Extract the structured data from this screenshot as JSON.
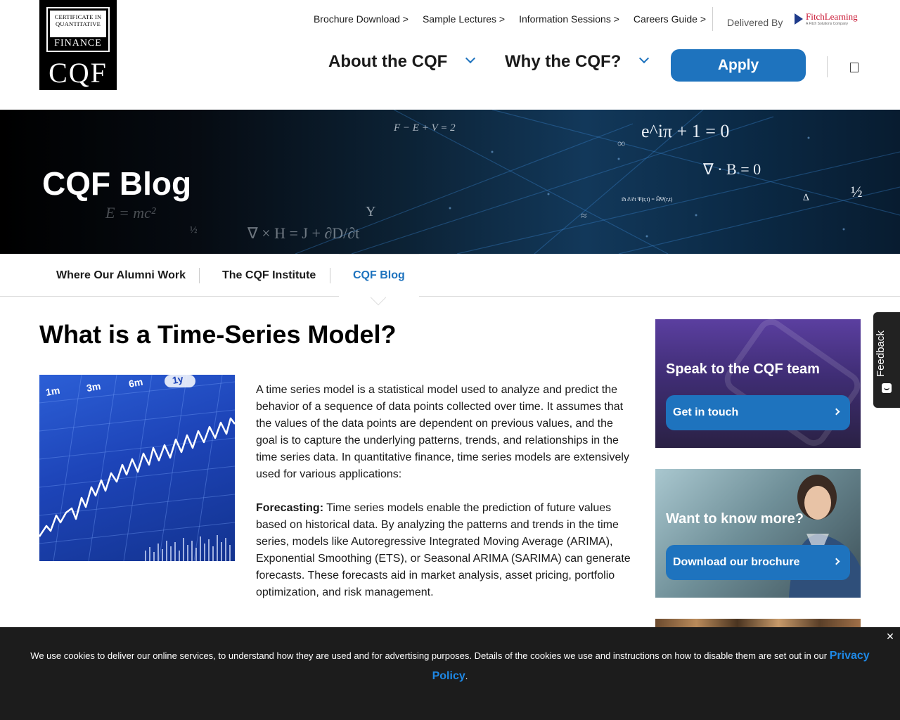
{
  "header": {
    "logo": {
      "line1": "CERTIFICATE IN",
      "line2": "QUANTITATIVE",
      "line3": "FINANCE",
      "mark": "CQF"
    },
    "top_links": [
      "Brochure Download >",
      "Sample Lectures >",
      "Information Sessions >",
      "Careers Guide >"
    ],
    "delivered_by": "Delivered By",
    "partner": {
      "name": "FitchLearning",
      "tagline": "A Fitch Solutions Company"
    },
    "nav": [
      {
        "label": "About the CQF",
        "icon": "chevron-down-icon"
      },
      {
        "label": "Why the CQF?",
        "icon": "chevron-down-icon"
      }
    ],
    "apply_label": "Apply",
    "search_icon": "search-icon"
  },
  "hero": {
    "title": "CQF Blog",
    "equations": [
      "F − E + V = 2",
      "e^iπ + 1 = 0",
      "∇ · B = 0",
      "E = mc²",
      "∇ × H = J + ∂D/∂t",
      "½",
      "½",
      "∆",
      "≈",
      "Υ",
      "∞",
      "iħ ∂/∂t Ψ(r,t) = ĤΨ(r,t)"
    ]
  },
  "subnav": {
    "items": [
      "Where Our Alumni Work",
      "The CQF Institute",
      "CQF Blog"
    ],
    "active_index": 2
  },
  "article": {
    "title": "What is a Time-Series Model?",
    "image_labels": [
      "1m",
      "3m",
      "6m",
      "1y"
    ],
    "intro": "A time series model is a statistical model used to analyze and predict the behavior of a sequence of data points collected over time. It assumes that the values of the data points are dependent on previous values, and the goal is to capture the underlying patterns, trends, and relationships in the time series data. In quantitative finance, time series models are extensively used for various applications:",
    "forecasting_label": "Forecasting:",
    "forecasting_text": " Time series models enable the prediction of future values based on historical data. By analyzing the patterns and trends in the time series, models like Autoregressive Integrated Moving Average (ARIMA), Exponential Smoothing (ETS), or Seasonal ARIMA (SARIMA) can generate forecasts. These forecasts aid in market analysis, asset pricing, portfolio optimization, and risk management."
  },
  "sidebar": {
    "card1": {
      "title": "Speak to the CQF team",
      "button": "Get in touch"
    },
    "card2": {
      "title": "Want to know more?",
      "button": "Download our brochure"
    }
  },
  "feedback": {
    "label": "Feedback"
  },
  "cookie": {
    "message": "We use cookies to deliver our online services, to understand how they are used and for advertising purposes. Details of the cookies we use and instructions on how to disable them are set out in our ",
    "link": "Privacy Policy",
    "end": ".",
    "close": "✕"
  },
  "colors": {
    "accent": "#1e73be",
    "hero_dark": "#000000",
    "cookie_bg": "#1c1c1c",
    "card1_bg": "#4a3386"
  }
}
